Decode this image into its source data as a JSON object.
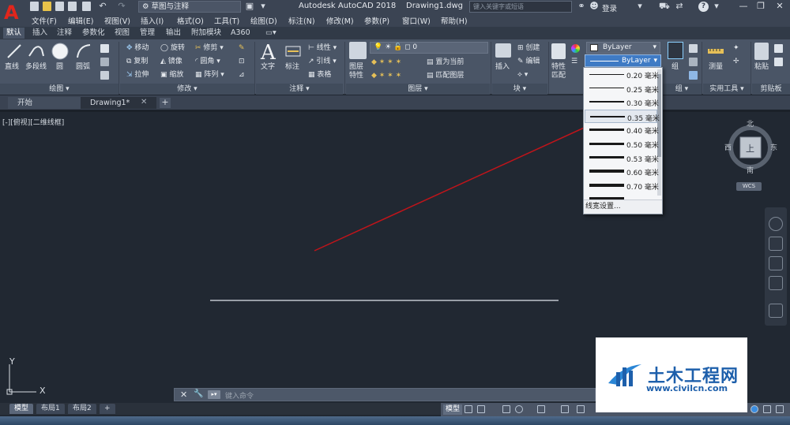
{
  "title_bar": {
    "workspace": "草图与注释",
    "app_title": "Autodesk AutoCAD 2018",
    "document": "Drawing1.dwg",
    "search_placeholder": "键入关键字或短语",
    "login": "登录"
  },
  "menu": [
    "文件(F)",
    "编辑(E)",
    "视图(V)",
    "插入(I)",
    "格式(O)",
    "工具(T)",
    "绘图(D)",
    "标注(N)",
    "修改(M)",
    "参数(P)",
    "窗口(W)",
    "帮助(H)"
  ],
  "ribbon_tabs": [
    "默认",
    "插入",
    "注释",
    "参数化",
    "视图",
    "管理",
    "输出",
    "附加模块",
    "A360"
  ],
  "ribbon": {
    "draw": {
      "line": "直线",
      "polyline": "多段线",
      "circle": "圆",
      "arc": "圆弧",
      "panel": "绘图"
    },
    "modify": {
      "move": "移动",
      "rotate": "旋转",
      "trim": "修剪",
      "copy": "复制",
      "mirror": "镜像",
      "fillet": "圆角",
      "stretch": "拉伸",
      "scale": "缩放",
      "array": "阵列",
      "panel": "修改"
    },
    "annotation": {
      "text": "文字",
      "dimension": "标注",
      "linear": "线性",
      "leader": "引线",
      "table": "表格",
      "panel": "注释"
    },
    "layers": {
      "properties": "图层\n特性",
      "current_layer": "0",
      "set_current": "置为当前",
      "match_layer": "匹配图层",
      "panel": "图层"
    },
    "block": {
      "insert": "插入",
      "create": "创建",
      "edit": "编辑",
      "panel": "块"
    },
    "properties": {
      "match": "特性\n匹配",
      "color": "ByLayer",
      "lineweight": "ByLayer"
    },
    "groups": {
      "group": "组",
      "panel": "组"
    },
    "utilities": {
      "measure": "测量",
      "panel": "实用工具"
    },
    "clipboard": {
      "paste": "粘贴",
      "panel": "剪贴板"
    }
  },
  "file_tabs": {
    "start": "开始",
    "drawing": "Drawing1*"
  },
  "viewport_label": "[-][俯视][二维线框]",
  "lineweight_options": [
    {
      "label": "0.20 毫米",
      "weight": 1
    },
    {
      "label": "0.25 毫米",
      "weight": 1.5
    },
    {
      "label": "0.30 毫米",
      "weight": 2
    },
    {
      "label": "0.35 毫米",
      "weight": 2.5
    },
    {
      "label": "0.40 毫米",
      "weight": 3
    },
    {
      "label": "0.50 毫米",
      "weight": 3
    },
    {
      "label": "0.53 毫米",
      "weight": 3.5
    },
    {
      "label": "0.60 毫米",
      "weight": 3.5
    },
    {
      "label": "0.70 毫米",
      "weight": 4
    },
    {
      "label": "",
      "weight": 4
    }
  ],
  "lineweight_hovered": "0.35 毫米",
  "lineweight_settings": "线宽设置...",
  "viewcube": {
    "north": "北",
    "south": "南",
    "east": "东",
    "west": "西",
    "top": "上",
    "ucs": "WCS"
  },
  "ucs_axes": {
    "x": "X",
    "y": "Y"
  },
  "command_line": {
    "placeholder": "键入命令"
  },
  "layout_tabs": [
    "模型",
    "布局1",
    "布局2"
  ],
  "status": {
    "model": "模型"
  },
  "watermark": {
    "title": "土木工程网",
    "url": "www.civilcn.com"
  },
  "colors": {
    "canvas": "#212832",
    "arrow": "#c0141a",
    "hover": "#3f7bc5"
  }
}
